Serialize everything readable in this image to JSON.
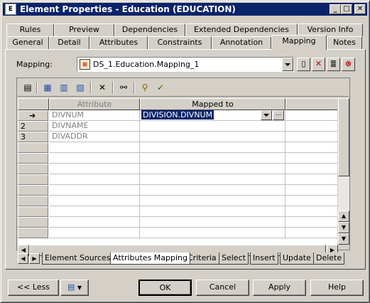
{
  "window": {
    "title": "Element Properties - Education (EDUCATION)",
    "app_icon_letter": "E",
    "minimize_glyph": "_",
    "maximize_glyph": "□",
    "close_glyph": "✕"
  },
  "tabs_row1": [
    "Rules",
    "Preview",
    "Dependencies",
    "Extended Dependencies",
    "Version Info"
  ],
  "tabs_row2": [
    "General",
    "Detail",
    "Attributes",
    "Constraints",
    "Annotation",
    "Mapping",
    "Notes"
  ],
  "active_tab": "Mapping",
  "mapping": {
    "label": "Mapping:",
    "value": "DS_1.Education.Mapping_1"
  },
  "grid": {
    "columns": [
      "Attribute",
      "Mapped to"
    ],
    "rows": [
      {
        "num": "",
        "attribute": "DIVNUM",
        "mapped_to": "DIVISION.DIVNUM"
      },
      {
        "num": "2",
        "attribute": "DIVNAME",
        "mapped_to": ""
      },
      {
        "num": "3",
        "attribute": "DIVADDR",
        "mapped_to": ""
      }
    ],
    "ellipsis": "..."
  },
  "bottom_tabs": [
    "Element Sources",
    "Attributes Mapping",
    "Criteria",
    "Select",
    "Insert",
    "Update",
    "Delete"
  ],
  "active_bottom_tab": "Attributes Mapping",
  "buttons": {
    "less": "<< Less",
    "ok": "OK",
    "cancel": "Cancel",
    "apply": "Apply",
    "help": "Help"
  },
  "colors": {
    "titlebar": "#0a246a",
    "selection": "#0a246a",
    "face": "#d4d0c8"
  }
}
